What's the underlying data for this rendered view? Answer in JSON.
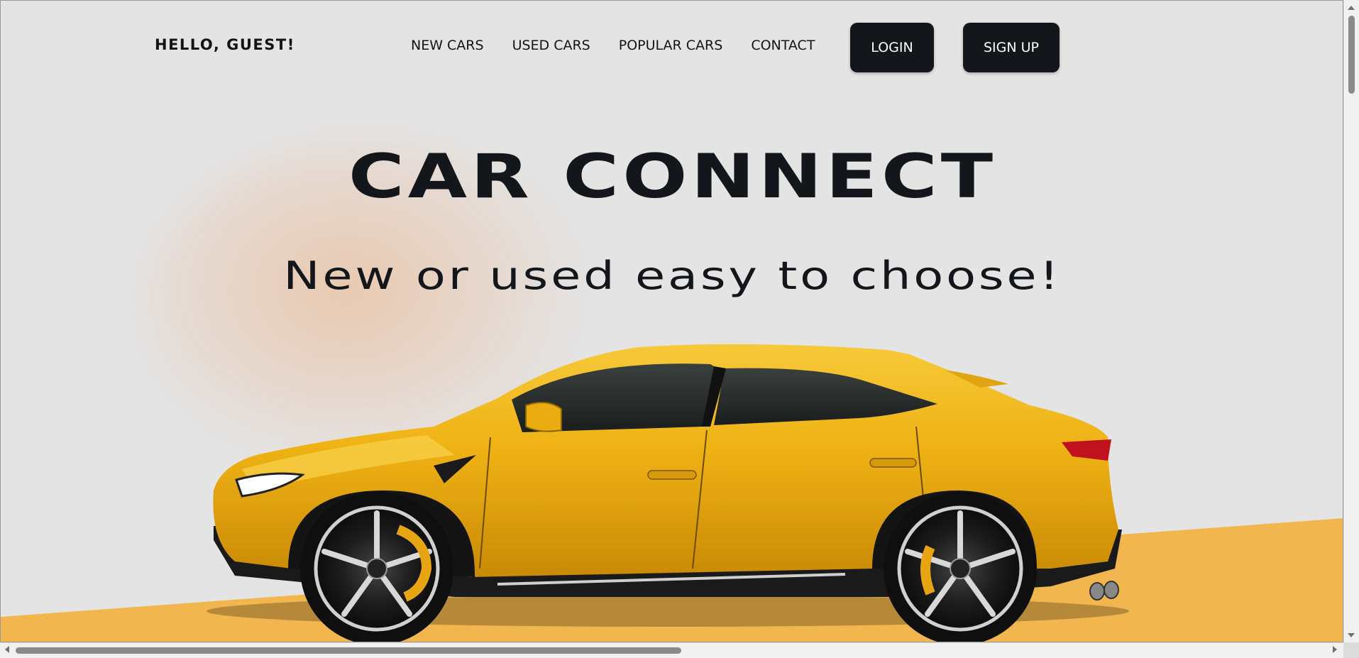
{
  "header": {
    "greeting": "HELLO, GUEST!",
    "nav_links": [
      "NEW CARS",
      "USED CARS",
      "POPULAR CARS",
      "CONTACT"
    ],
    "login_label": "LOGIN",
    "signup_label": "SIGN UP"
  },
  "hero": {
    "title": "CAR CONNECT",
    "subtitle": "New or used easy to choose!",
    "image_icon": "yellow-suv-image"
  },
  "colors": {
    "background": "#e4e4e4",
    "text_dark": "#13161b",
    "button_bg": "#13161b",
    "accent_yellow": "#f2b64e",
    "car_yellow": "#f0b412"
  },
  "scrollbars": {
    "vertical_position": 0,
    "horizontal_position": 0
  }
}
